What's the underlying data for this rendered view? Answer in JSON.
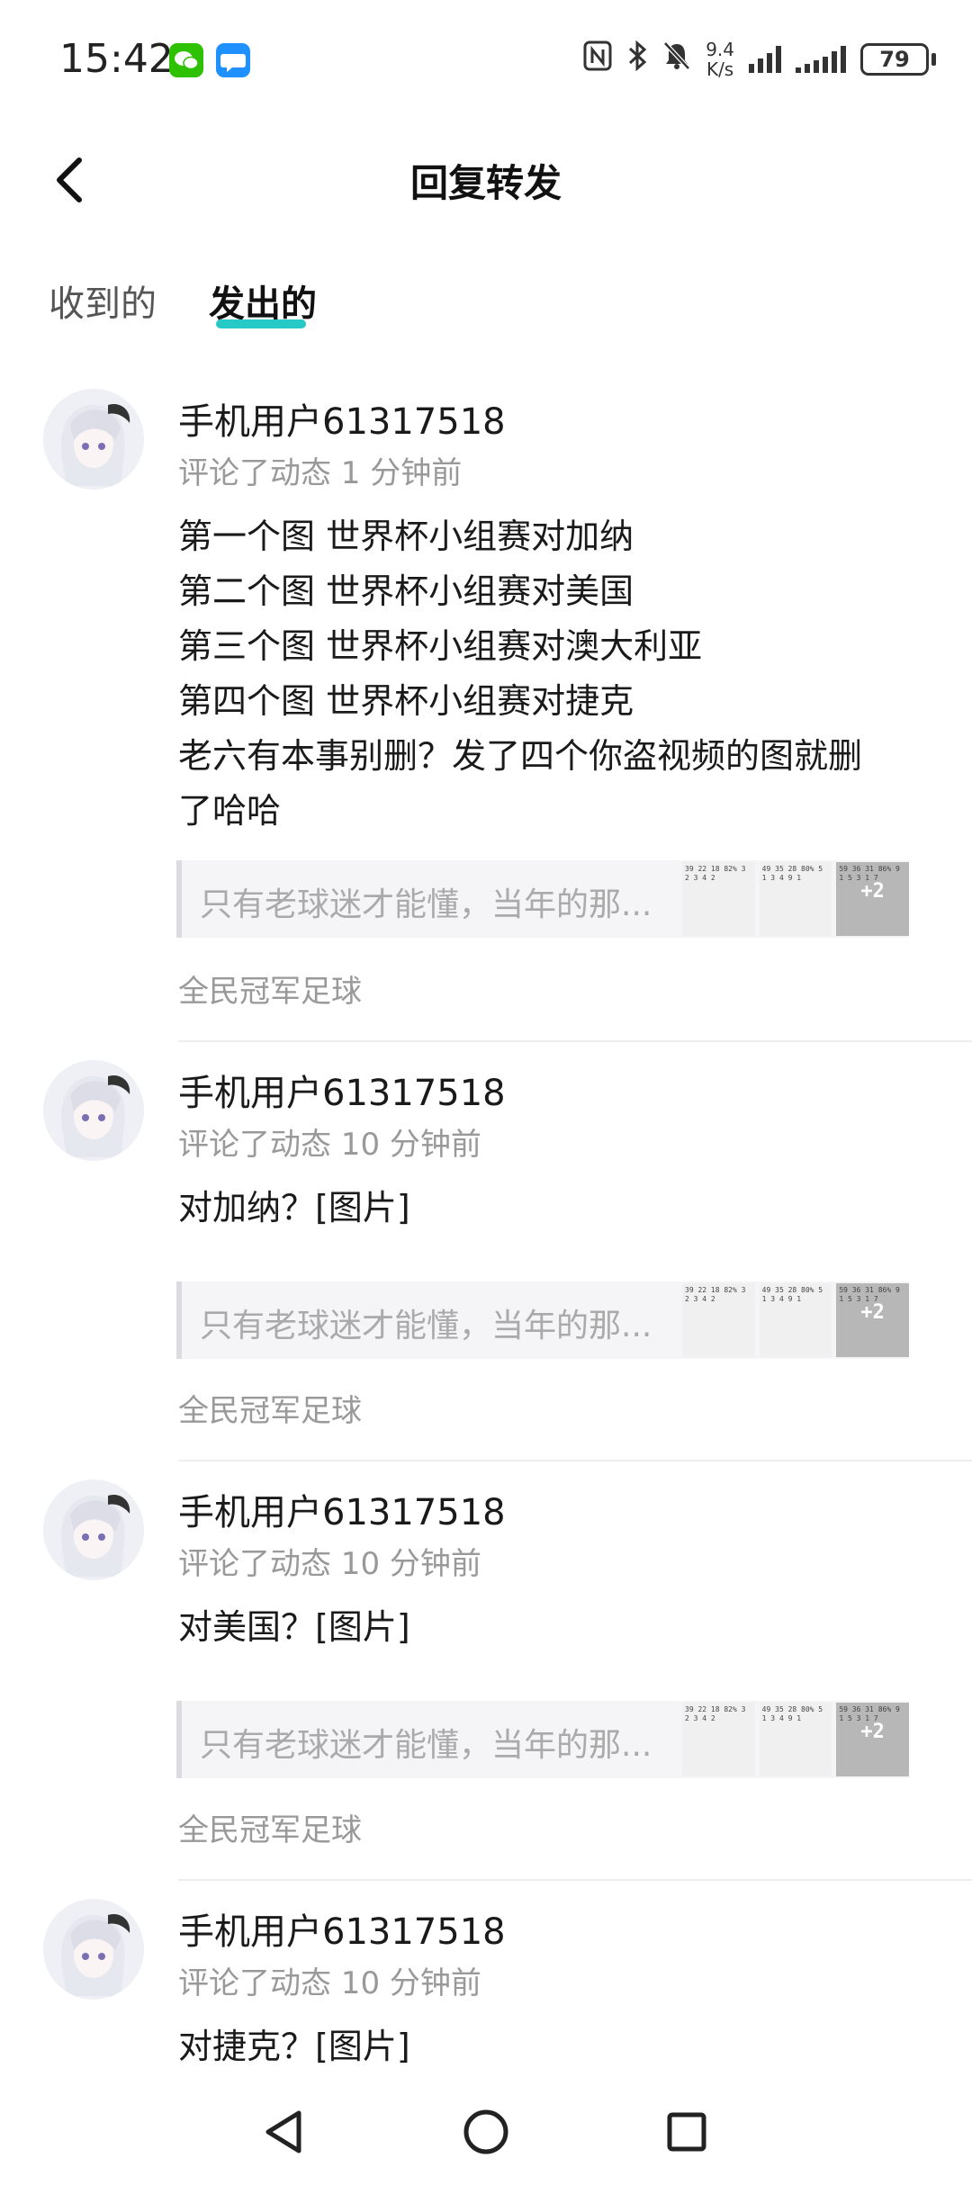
{
  "status_bar": {
    "time": "15:42",
    "apps": [
      {
        "icon": "wechat-icon",
        "color": "#2dc100"
      },
      {
        "icon": "message-icon",
        "color": "#1e90ff"
      }
    ],
    "net_speed_value": "9.4",
    "net_speed_unit": "K/s",
    "battery": "79"
  },
  "header": {
    "title": "回复转发"
  },
  "tabs": [
    {
      "label": "收到的",
      "active": false
    },
    {
      "label": "发出的",
      "active": true
    }
  ],
  "accent_color": "#25c9c6",
  "items": [
    {
      "username": "手机用户61317518",
      "meta": "评论了动态 1 分钟前",
      "lines": [
        "第一个图 世界杯小组赛对加纳",
        "第二个图 世界杯小组赛对美国",
        "第三个图 世界杯小组赛对澳大利亚",
        "第四个图 世界杯小组赛对捷克",
        "老六有本事别删？发了四个你盗视频的图就删",
        "了哈哈"
      ],
      "quote": "只有老球迷才能懂，当年的那...",
      "thumb_more": "+2",
      "source": "全民冠军足球"
    },
    {
      "username": "手机用户61317518",
      "meta": "评论了动态 10 分钟前",
      "lines": [
        "对加纳？[图片]"
      ],
      "quote": "只有老球迷才能懂，当年的那...",
      "thumb_more": "+2",
      "source": "全民冠军足球"
    },
    {
      "username": "手机用户61317518",
      "meta": "评论了动态 10 分钟前",
      "lines": [
        "对美国？[图片]"
      ],
      "quote": "只有老球迷才能懂，当年的那...",
      "thumb_more": "+2",
      "source": "全民冠军足球"
    },
    {
      "username": "手机用户61317518",
      "meta": "评论了动态 10 分钟前",
      "lines": [
        "对捷克？[图片]"
      ]
    }
  ],
  "nav": [
    "back-triangle-icon",
    "home-circle-icon",
    "recents-square-icon"
  ]
}
